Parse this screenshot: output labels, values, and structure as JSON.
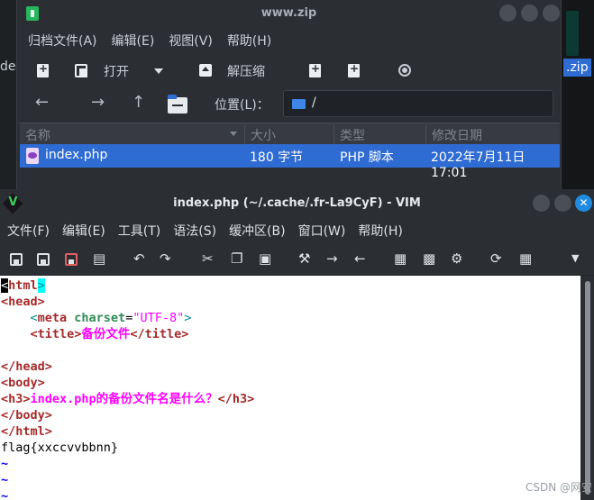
{
  "desktop": {
    "left_partial_text": "de",
    "right_zip_label": ".zip"
  },
  "archive_window": {
    "title": "www.zip",
    "menu": [
      "归档文件(A)",
      "编辑(E)",
      "视图(V)",
      "帮助(H)"
    ],
    "toolbar": {
      "open_label": "打开",
      "extract_label": "解压缩"
    },
    "location": {
      "label": "位置(L)：",
      "path": "/"
    },
    "columns": [
      "名称",
      "大小",
      "类型",
      "修改日期"
    ],
    "files": [
      {
        "name": "index.php",
        "size": "180 字节",
        "type": "PHP 脚本",
        "modified": "2022年7月11日 17:01"
      }
    ]
  },
  "vim_window": {
    "title": "index.php (~/.cache/.fr-La9CyF) - VIM",
    "close_glyph": "✕",
    "menu": [
      "文件(F)",
      "编辑(E)",
      "工具(T)",
      "语法(S)",
      "缓冲区(B)",
      "窗口(W)",
      "帮助(H)"
    ],
    "code": {
      "l1_lt": "<",
      "l1_tag": "html",
      "l1_gt": ">",
      "l2": "<head>",
      "l3_pre": "    <",
      "l3_tag": "meta",
      "l3_attr": " charset",
      "l3_eq": "=",
      "l3_val": "\"UTF-8\"",
      "l3_end": ">",
      "l4_pre": "    <title>",
      "l4_text": "备份文件",
      "l4_end": "</title>",
      "l6": "</head>",
      "l7": "<body>",
      "l8_open": "<h3>",
      "l8_text": "index.php的备份文件名是什么？",
      "l8_close": "</h3>",
      "l9": "</body>",
      "l10": "</html>",
      "l11": "flag{xxccvvbbnn}",
      "tilde": "~"
    }
  },
  "watermark": "CSDN @网安"
}
